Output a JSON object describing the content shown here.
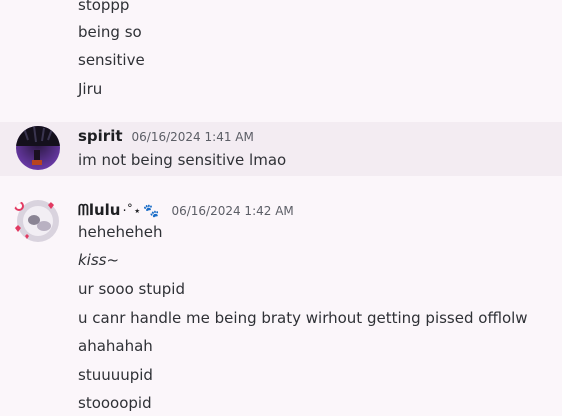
{
  "messages_top": {
    "lines": [
      "stoppp",
      "being so",
      "sensitive",
      "Jiru"
    ]
  },
  "message_spirit": {
    "username": "spirit",
    "timestamp": "06/16/2024 1:41 AM",
    "text": "im not being sensitive lmao"
  },
  "message_lulu": {
    "username": "ᗰlulu",
    "username_deco": "·˚⋆",
    "username_paw": "🐾",
    "timestamp": "06/16/2024 1:42 AM",
    "lines": [
      "heheheheh",
      "kiss~",
      "ur sooo stupid",
      "u canr handle me being braty wirhout getting pissed offlolw",
      "ahahahah",
      "stuuuupid",
      "stoooopid"
    ]
  },
  "colors": {
    "background": "#fbf6fa",
    "highlight_row": "#f3ecf2",
    "spirit_avatar": "#4b2a7a"
  }
}
